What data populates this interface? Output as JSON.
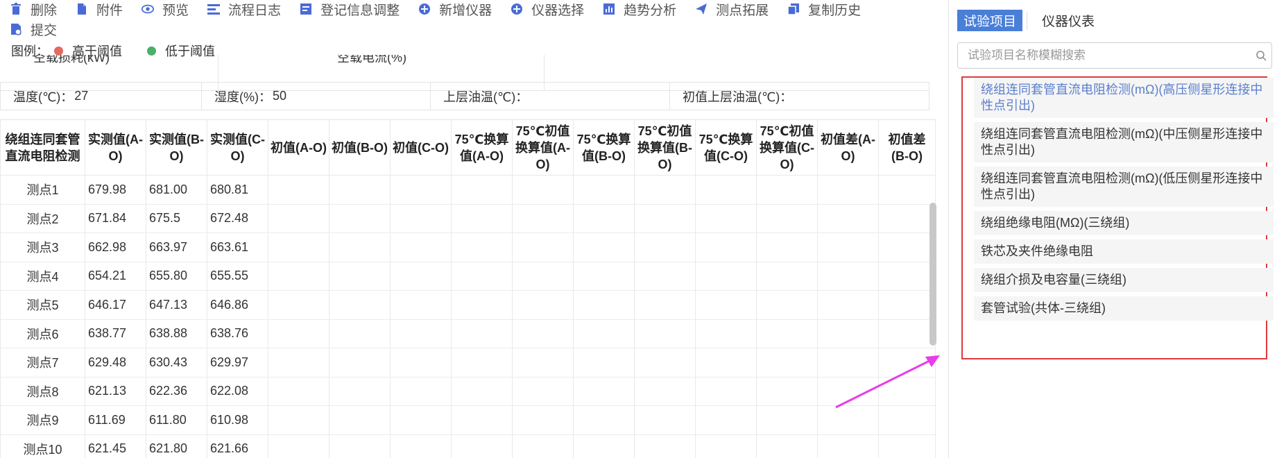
{
  "toolbar": {
    "row1": [
      {
        "label": "删除",
        "icon": "trash-icon"
      },
      {
        "label": "附件",
        "icon": "attachment-icon"
      },
      {
        "label": "预览",
        "icon": "eye-icon"
      },
      {
        "label": "流程日志",
        "icon": "flow-log-icon"
      },
      {
        "label": "登记信息调整",
        "icon": "form-adjust-icon"
      },
      {
        "label": "新增仪器",
        "icon": "plus-circle-icon"
      },
      {
        "label": "仪器选择",
        "icon": "plus-circle-icon"
      },
      {
        "label": "趋势分析",
        "icon": "chart-icon"
      },
      {
        "label": "测点拓展",
        "icon": "send-icon"
      },
      {
        "label": "复制历史",
        "icon": "copy-icon"
      }
    ],
    "row2": [
      {
        "label": "提交",
        "icon": "submit-icon"
      }
    ]
  },
  "legend": {
    "title": "图例：",
    "high_label": "高于阈值",
    "high_color": "#e4695e",
    "low_label": "低于阈值",
    "low_color": "#4caf6a"
  },
  "cut_row": {
    "left": "空载损耗(kW)",
    "right": "空载电流(%)"
  },
  "env": {
    "temp_label": "温度(℃)：",
    "temp_value": "27",
    "humidity_label": "湿度(%)：",
    "humidity_value": "50",
    "oil_label": "上层油温(℃)：",
    "init_oil_label": "初值上层油温(℃)："
  },
  "table": {
    "headers": [
      "绕组连同套管直流电阻检测",
      "实测值(A-O)",
      "实测值(B-O)",
      "实测值(C-O)",
      "初值(A-O)",
      "初值(B-O)",
      "初值(C-O)",
      "75℃换算值(A-O)",
      "75℃初值换算值(A-O)",
      "75℃换算值(B-O)",
      "75℃初值换算值(B-O)",
      "75℃换算值(C-O)",
      "75℃初值换算值(C-O)",
      "初值差(A-O)",
      "初值差(B-O)"
    ],
    "rows": [
      [
        "测点1",
        "679.98",
        "681.00",
        "680.81"
      ],
      [
        "测点2",
        "671.84",
        "675.5",
        "672.48"
      ],
      [
        "测点3",
        "662.98",
        "663.97",
        "663.61"
      ],
      [
        "测点4",
        "654.21",
        "655.80",
        "655.55"
      ],
      [
        "测点5",
        "646.17",
        "647.13",
        "646.86"
      ],
      [
        "测点6",
        "638.77",
        "638.88",
        "638.76"
      ],
      [
        "测点7",
        "629.48",
        "630.43",
        "629.97"
      ],
      [
        "测点8",
        "621.13",
        "622.36",
        "622.08"
      ],
      [
        "测点9",
        "611.69",
        "611.80",
        "610.98"
      ],
      [
        "测点10",
        "621.45",
        "621.80",
        "621.66"
      ]
    ]
  },
  "panel": {
    "tab_active": "试验项目",
    "tab_inactive": "仪器仪表",
    "search_placeholder": "试验项目名称模糊搜索",
    "items": [
      "绕组连同套管直流电阻检测(mΩ)(高压侧星形连接中性点引出)",
      "绕组连同套管直流电阻检测(mΩ)(中压侧星形连接中性点引出)",
      "绕组连同套管直流电阻检测(mΩ)(低压侧星形连接中性点引出)",
      "绕组绝缘电阻(MΩ)(三绕组)",
      "铁芯及夹件绝缘电阻",
      "绕组介损及电容量(三绕组)",
      "套管试验(共体-三绕组)"
    ],
    "selected_index": 0,
    "highlight_color": "#e0393e"
  },
  "annotation_arrow_color": "#e83de8"
}
